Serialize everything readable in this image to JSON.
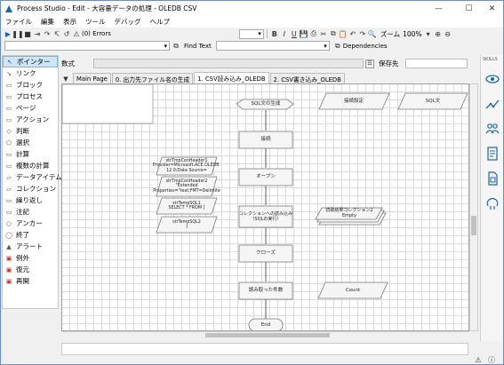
{
  "window": {
    "title": "Process Studio  - Edit - 大容量データの処理 - OLEDB CSV"
  },
  "menu": [
    "ファイル",
    "編集",
    "表示",
    "ツール",
    "デバッグ",
    "ヘルプ"
  ],
  "toolbar": {
    "errors_label": "(0) Errors",
    "find_label": "Find Text",
    "zoom_label": "ズーム",
    "zoom_value": "100%",
    "dependencies_label": "Dependencies"
  },
  "palette": [
    {
      "label": "ポインター",
      "icon": "pointer-icon",
      "selected": true
    },
    {
      "label": "リンク",
      "icon": "link-icon"
    },
    {
      "label": "ブロック",
      "icon": "block-icon"
    },
    {
      "label": "プロセス",
      "icon": "process-icon"
    },
    {
      "label": "ページ",
      "icon": "page-icon"
    },
    {
      "label": "アクション",
      "icon": "action-icon"
    },
    {
      "label": "判断",
      "icon": "decision-icon"
    },
    {
      "label": "選択",
      "icon": "choice-icon"
    },
    {
      "label": "計算",
      "icon": "calculation-icon"
    },
    {
      "label": "複数の計算",
      "icon": "multi-calc-icon"
    },
    {
      "label": "データアイテム",
      "icon": "data-item-icon"
    },
    {
      "label": "コレクション",
      "icon": "collection-icon"
    },
    {
      "label": "繰り返し",
      "icon": "loop-icon"
    },
    {
      "label": "注記",
      "icon": "note-icon"
    },
    {
      "label": "アンカー",
      "icon": "anchor-icon"
    },
    {
      "label": "終了",
      "icon": "end-icon"
    },
    {
      "label": "アラート",
      "icon": "alert-icon"
    },
    {
      "label": "例外",
      "icon": "exception-icon"
    },
    {
      "label": "復元",
      "icon": "recover-icon"
    },
    {
      "label": "再開",
      "icon": "resume-icon"
    }
  ],
  "properties": {
    "formula_label": "数式",
    "store_in_label": "保存先"
  },
  "tabs": [
    "Main Page",
    "0. 出力先ファイル名の生成",
    "1. CSV読み込み_OLEDB",
    "2. CSV書き込み_OLEDB"
  ],
  "active_tab": 2,
  "skills_label": "SKILLS",
  "flow": {
    "sql_gen": "SQL文の生成",
    "conn_settings": "接続設定",
    "sql_text": "SQL文",
    "connect": "接続",
    "open": "オープン",
    "read_collection": "コレクションへの読み込み\n（SQLの実行）",
    "result_collection": "読取結果コレクション2\nEmpty",
    "close": "クローズ",
    "read_count": "読み取った件数",
    "count": "Count",
    "end": "End",
    "conn_header1": "strTmpConHeader1\nProvider=Microsoft.ACE.OLEDB.\n12.0;Data Source=",
    "conn_header2": "strTmpConHeader2\n\"Extended\nProperties=\"text;FMT=Delimite",
    "sql1": "strTempSQL1\nSELECT * FROM [",
    "sql2": "strTempSQL2\n]"
  }
}
